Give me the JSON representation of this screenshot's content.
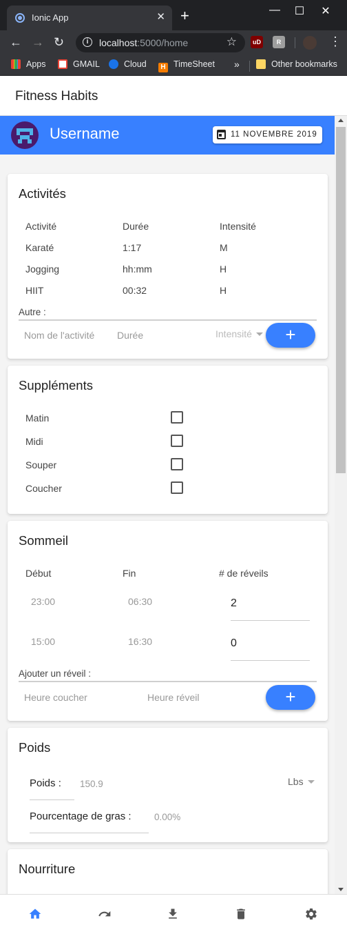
{
  "browser": {
    "tab_title": "Ionic App",
    "tab_close": "✕",
    "new_tab": "+",
    "win_min": "—",
    "win_max": "☐",
    "win_close": "✕",
    "back": "←",
    "forward": "→",
    "reload": "↻",
    "url_host": "localhost",
    "url_path": ":5000/home",
    "star": "☆",
    "ext_ub": "uD",
    "ext_r": "R",
    "menu": "⋮",
    "bookmarks": {
      "apps": "Apps",
      "gmail": "GMAIL",
      "cloud": "Cloud",
      "timesheet": "TimeSheet",
      "timesheet_icon": "H",
      "more": "»",
      "other": "Other bookmarks"
    }
  },
  "app": {
    "title": "Fitness Habits",
    "username": "Username",
    "date": "11 NOVEMBRE 2019"
  },
  "activities": {
    "title": "Activités",
    "headers": [
      "Activité",
      "Durée",
      "Intensité"
    ],
    "rows": [
      [
        "Karaté",
        "1:17",
        "M"
      ],
      [
        "Jogging",
        "hh:mm",
        "H"
      ],
      [
        "HIIT",
        "00:32",
        "H"
      ]
    ],
    "other_label": "Autre :",
    "name_placeholder": "Nom de l'activité",
    "duration_placeholder": "Durée",
    "intensity_placeholder": "Intensité",
    "add_label": "+"
  },
  "supplements": {
    "title": "Suppléments",
    "items": [
      {
        "label": "Matin",
        "checked": false
      },
      {
        "label": "Midi",
        "checked": false
      },
      {
        "label": "Souper",
        "checked": false
      },
      {
        "label": "Coucher",
        "checked": false
      }
    ]
  },
  "sleep": {
    "title": "Sommeil",
    "headers": [
      "Début",
      "Fin",
      "# de réveils"
    ],
    "rows": [
      [
        "23:00",
        "06:30",
        "2"
      ],
      [
        "15:00",
        "16:30",
        "0"
      ]
    ],
    "add_label_text": "Ajouter un réveil :",
    "bed_placeholder": "Heure coucher",
    "wake_placeholder": "Heure réveil",
    "add_label": "+"
  },
  "weight": {
    "title": "Poids",
    "weight_label": "Poids :",
    "weight_value": "150.9",
    "unit": "Lbs",
    "fat_label": "Pourcentage de gras :",
    "fat_value": "0.00%"
  },
  "food": {
    "title": "Nourriture"
  },
  "icons": {
    "home": "home-icon",
    "redo": "redo-icon",
    "download": "download-icon",
    "trash": "trash-icon",
    "settings": "settings-icon"
  },
  "colors": {
    "primary": "#3880ff",
    "chrome_dark": "#202124",
    "chrome_toolbar": "#35363a"
  }
}
